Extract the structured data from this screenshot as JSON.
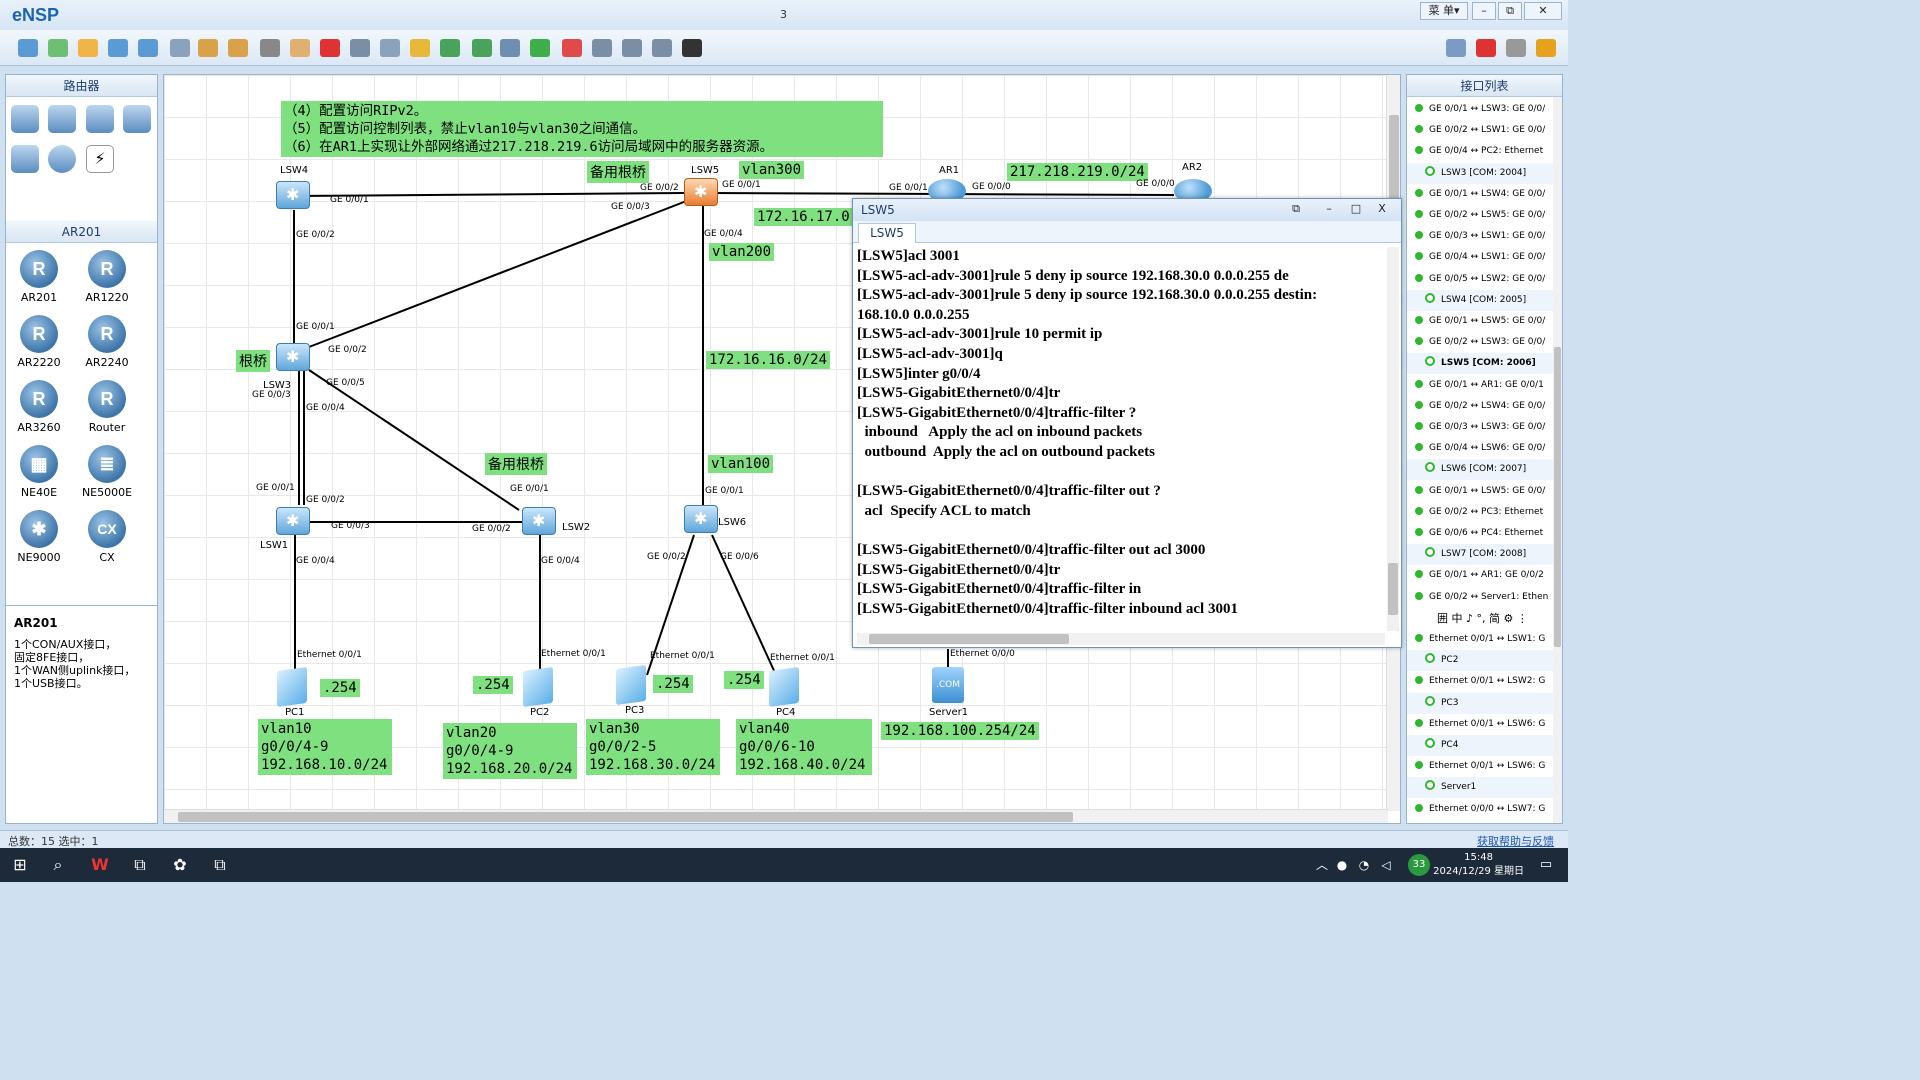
{
  "app": {
    "title": "eNSP",
    "window_count": "3",
    "menu_label": "菜 单▾",
    "min": "–",
    "restore": "⧉",
    "close": "✕"
  },
  "toolbar": {
    "icons": [
      "new-topology-icon",
      "new-example-icon",
      "open-icon",
      "save-icon",
      "save-as-icon",
      "print-icon",
      "undo-icon",
      "redo-icon",
      "select-icon",
      "pan-icon",
      "delete-icon",
      "delete-link-icon",
      "text-icon",
      "palette-icon",
      "zoom-in-icon",
      "zoom-out-icon",
      "fit-icon",
      "start-device-icon",
      "stop-device-icon",
      "capture-icon",
      "topology-icon",
      "grid-icon",
      "terminal-icon"
    ],
    "right_icons": [
      "chat-icon",
      "huawei-icon",
      "settings-icon",
      "help-icon"
    ]
  },
  "left_panel": {
    "category_title": "路由器",
    "device_list_title": "AR201",
    "devices": [
      {
        "label": "AR201",
        "glyph": "R"
      },
      {
        "label": "AR1220",
        "glyph": "R"
      },
      {
        "label": "AR2220",
        "glyph": "R"
      },
      {
        "label": "AR2240",
        "glyph": "R"
      },
      {
        "label": "AR3260",
        "glyph": "R"
      },
      {
        "label": "Router",
        "glyph": "R"
      },
      {
        "label": "NE40E",
        "glyph": "▦"
      },
      {
        "label": "NE5000E",
        "glyph": "≣"
      },
      {
        "label": "NE9000",
        "glyph": "✱"
      },
      {
        "label": "CX",
        "glyph": "CX"
      }
    ],
    "info": {
      "title": "AR201",
      "lines": [
        "1个CON/AUX接口，",
        "固定8FE接口，",
        "1个WAN侧uplink接口，",
        "1个USB接口。"
      ]
    }
  },
  "canvas": {
    "task_note": [
      "（4）配置访问RIPv2。",
      "（5）配置访问控制列表，禁止vlan10与vlan30之间通信。",
      "（6）在AR1上实现让外部网络通过217.218.219.6访问局域网中的服务器资源。"
    ],
    "notes": {
      "backup_root_top": "备用根桥",
      "vlan300": "vlan300",
      "net_217": "217.218.219.0/24",
      "net_172_17": "172.16.17.0",
      "vlan200": "vlan200",
      "root": "根桥",
      "net_172_16": "172.16.16.0/24",
      "backup_root_mid": "备用根桥",
      "vlan100": "vlan100",
      "pc1_ip": ".254",
      "pc2_ip": ".254",
      "pc3_ip": ".254",
      "pc4_ip": ".254",
      "vlan10": [
        "vlan10",
        "g0/0/4-9",
        "192.168.10.0/24"
      ],
      "vlan20": [
        "vlan20",
        "g0/0/4-9",
        "192.168.20.0/24"
      ],
      "vlan30": [
        "vlan30",
        "g0/0/2-5",
        "192.168.30.0/24"
      ],
      "vlan40": [
        "vlan40",
        "g0/0/6-10",
        "192.168.40.0/24"
      ],
      "server_net": "192.168.100.254/24"
    },
    "devices": {
      "lsw4": "LSW4",
      "lsw5": "LSW5",
      "lsw3": "LSW3",
      "lsw1": "LSW1",
      "lsw2": "LSW2",
      "lsw6": "LSW6",
      "ar1": "AR1",
      "ar2": "AR2",
      "pc1": "PC1",
      "pc2": "PC2",
      "pc3": "PC3",
      "pc4": "PC4",
      "server1": "Server1",
      "server_glyph": ".COM"
    },
    "ports": {
      "lsw4_g1": "GE 0/0/1",
      "lsw4_g2": "GE 0/0/2",
      "lsw5_g2": "GE 0/0/2",
      "lsw5_g1": "GE 0/0/1",
      "lsw5_g3": "GE 0/0/3",
      "lsw5_g4": "GE 0/0/4",
      "ar1_g1": "GE 0/0/1",
      "ar1_g0": "GE 0/0/0",
      "ar2_g0": "GE 0/0/0",
      "lsw3_g1": "GE 0/0/1",
      "lsw3_g2": "GE 0/0/2",
      "lsw3_g5": "GE 0/0/5",
      "lsw3_g3": "GE 0/0/3",
      "lsw3_g4": "GE 0/0/4",
      "lsw1_g1": "GE 0/0/1",
      "lsw1_g2": "GE 0/0/2",
      "lsw1_g3": "GE 0/0/3",
      "lsw1_g4": "GE 0/0/4",
      "lsw2_g1": "GE 0/0/1",
      "lsw2_g2": "GE 0/0/2",
      "lsw2_g4": "GE 0/0/4",
      "lsw6_g1": "GE 0/0/1",
      "lsw6_g2": "GE 0/0/2",
      "lsw6_g6": "GE 0/0/6",
      "pc1_e": "Ethernet 0/0/1",
      "pc2_e": "Ethernet 0/0/1",
      "pc3_e": "Ethernet 0/0/1",
      "pc4_e": "Ethernet 0/0/1",
      "srv_e": "Ethernet 0/0/0"
    }
  },
  "console": {
    "title": "LSW5",
    "tab": "LSW5",
    "restore": "⧉",
    "min": "–",
    "max": "□",
    "close": "X",
    "lines": [
      "[LSW5]acl 3001",
      "[LSW5-acl-adv-3001]rule 5 deny ip source 192.168.30.0 0.0.0.255 de",
      "[LSW5-acl-adv-3001]rule 5 deny ip source 192.168.30.0 0.0.0.255 destin:",
      "168.10.0 0.0.0.255",
      "[LSW5-acl-adv-3001]rule 10 permit ip",
      "[LSW5-acl-adv-3001]q",
      "[LSW5]inter g0/0/4",
      "[LSW5-GigabitEthernet0/0/4]tr",
      "[LSW5-GigabitEthernet0/0/4]traffic-filter ?",
      "  inbound   Apply the acl on inbound packets",
      "  outbound  Apply the acl on outbound packets",
      "",
      "[LSW5-GigabitEthernet0/0/4]traffic-filter out ?",
      "  acl  Specify ACL to match",
      "",
      "[LSW5-GigabitEthernet0/0/4]traffic-filter out acl 3000",
      "[LSW5-GigabitEthernet0/0/4]tr",
      "[LSW5-GigabitEthernet0/0/4]traffic-filter in",
      "[LSW5-GigabitEthernet0/0/4]traffic-filter inbound acl 3001"
    ]
  },
  "right_panel": {
    "title": "接口列表",
    "items": [
      {
        "text": "GE 0/0/1 ↔ LSW3: GE 0/0/",
        "grp": false
      },
      {
        "text": "GE 0/0/2 ↔ LSW1: GE 0/0/",
        "grp": false
      },
      {
        "text": "GE 0/0/4 ↔ PC2: Ethernet",
        "grp": false
      },
      {
        "text": "LSW3 [COM: 2004]",
        "grp": true
      },
      {
        "text": "GE 0/0/1 ↔ LSW4: GE 0/0/",
        "grp": false
      },
      {
        "text": "GE 0/0/2 ↔ LSW5: GE 0/0/",
        "grp": false
      },
      {
        "text": "GE 0/0/3 ↔ LSW1: GE 0/0/",
        "grp": false
      },
      {
        "text": "GE 0/0/4 ↔ LSW1: GE 0/0/",
        "grp": false
      },
      {
        "text": "GE 0/0/5 ↔ LSW2: GE 0/0/",
        "grp": false
      },
      {
        "text": "LSW4 [COM: 2005]",
        "grp": true
      },
      {
        "text": "GE 0/0/1 ↔ LSW5: GE 0/0/",
        "grp": false
      },
      {
        "text": "GE 0/0/2 ↔ LSW3: GE 0/0/",
        "grp": false
      },
      {
        "text": "LSW5 [COM: 2006]",
        "grp": true,
        "bold": true
      },
      {
        "text": "GE 0/0/1 ↔ AR1: GE 0/0/1",
        "grp": false
      },
      {
        "text": "GE 0/0/2 ↔ LSW4: GE 0/0/",
        "grp": false
      },
      {
        "text": "GE 0/0/3 ↔ LSW3: GE 0/0/",
        "grp": false
      },
      {
        "text": "GE 0/0/4 ↔ LSW6: GE 0/0/",
        "grp": false
      },
      {
        "text": "LSW6 [COM: 2007]",
        "grp": true
      },
      {
        "text": "GE 0/0/1 ↔ LSW5: GE 0/0/",
        "grp": false
      },
      {
        "text": "GE 0/0/2 ↔ PC3: Ethernet",
        "grp": false
      },
      {
        "text": "GE 0/0/6 ↔ PC4: Ethernet",
        "grp": false
      },
      {
        "text": "LSW7 [COM: 2008]",
        "grp": true
      },
      {
        "text": "GE 0/0/1 ↔ AR1: GE 0/0/2",
        "grp": false
      },
      {
        "text": "GE 0/0/2 ↔ Server1: Ethen",
        "grp": false
      },
      {
        "text": "囲 中 ♪ °, 简 ⚙ ⋮",
        "grp": false,
        "ime": true
      },
      {
        "text": "Ethernet 0/0/1 ↔ LSW1: G",
        "grp": false
      },
      {
        "text": "PC2",
        "grp": true
      },
      {
        "text": "Ethernet 0/0/1 ↔ LSW2: G",
        "grp": false
      },
      {
        "text": "PC3",
        "grp": true
      },
      {
        "text": "Ethernet 0/0/1 ↔ LSW6: G",
        "grp": false
      },
      {
        "text": "PC4",
        "grp": true
      },
      {
        "text": "Ethernet 0/0/1 ↔ LSW6: G",
        "grp": false
      },
      {
        "text": "Server1",
        "grp": true
      },
      {
        "text": "Ethernet 0/0/0 ↔ LSW7: G",
        "grp": false
      }
    ]
  },
  "status": {
    "left": "总数：15  选中：1",
    "right": "获取帮助与反馈"
  },
  "taskbar": {
    "time": "15:48",
    "date": "2024/12/29 星期日",
    "badge": "33"
  },
  "colors": {
    "note_green": "#7ee07e",
    "link_black": "#000000",
    "port_dot": "#3cb53c"
  }
}
